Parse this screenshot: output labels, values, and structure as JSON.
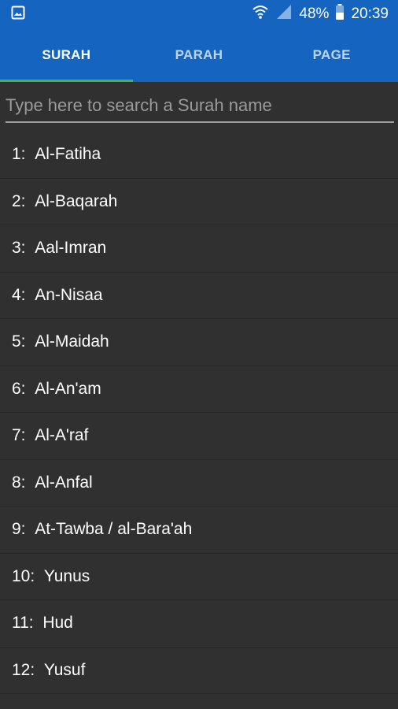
{
  "status_bar": {
    "notification_icon": "image-icon",
    "battery_percent": "48%",
    "time": "20:39",
    "icons": [
      "wifi-icon",
      "signal-icon",
      "battery-icon"
    ]
  },
  "tabs": [
    {
      "label": "SURAH",
      "active": true
    },
    {
      "label": "PARAH",
      "active": false
    },
    {
      "label": "PAGE",
      "active": false
    }
  ],
  "search": {
    "placeholder": "Type here to search a Surah name",
    "value": ""
  },
  "surahs": [
    {
      "number": "1:",
      "name": "Al-Fatiha"
    },
    {
      "number": "2:",
      "name": "Al-Baqarah"
    },
    {
      "number": "3:",
      "name": "Aal-Imran"
    },
    {
      "number": "4:",
      "name": "An-Nisaa"
    },
    {
      "number": "5:",
      "name": "Al-Maidah"
    },
    {
      "number": "6:",
      "name": "Al-An'am"
    },
    {
      "number": "7:",
      "name": "Al-A'raf"
    },
    {
      "number": "8:",
      "name": "Al-Anfal"
    },
    {
      "number": "9:",
      "name": "At-Tawba / al-Bara'ah"
    },
    {
      "number": "10:",
      "name": "Yunus"
    },
    {
      "number": "11:",
      "name": "Hud"
    },
    {
      "number": "12:",
      "name": "Yusuf"
    }
  ],
  "colors": {
    "primary": "#1565c0",
    "tab_indicator": "#4caf50",
    "background": "#303030"
  }
}
